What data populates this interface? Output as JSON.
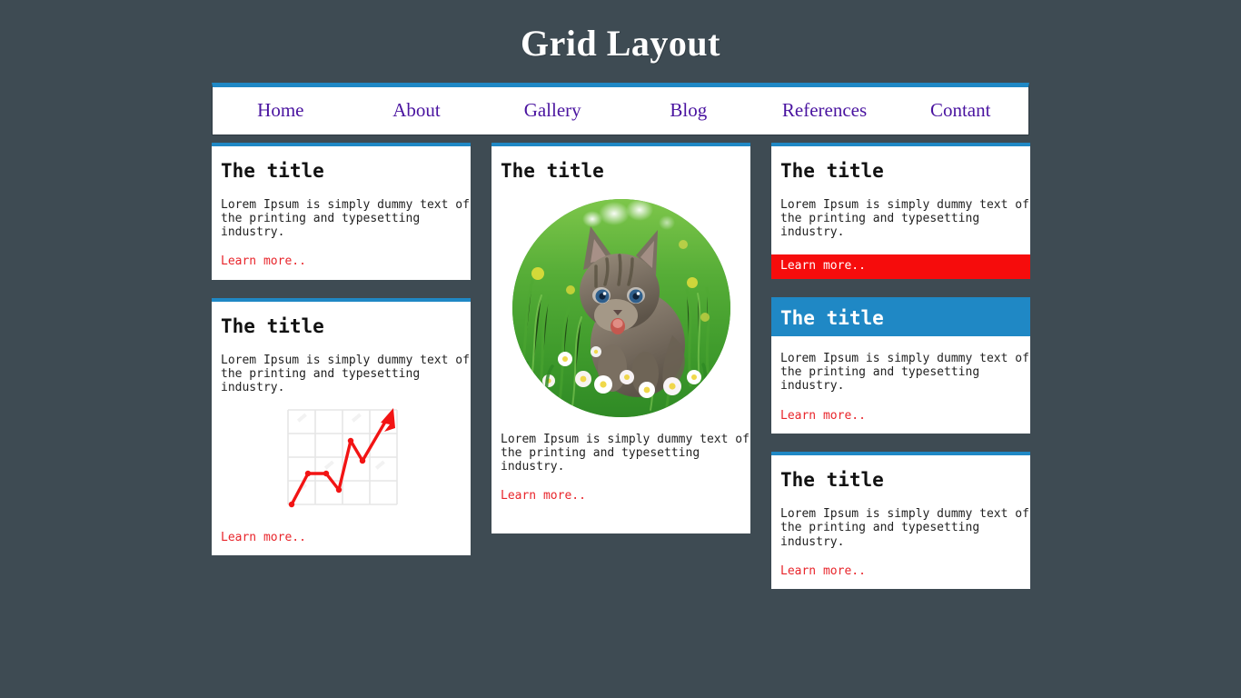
{
  "page": {
    "title": "Grid Layout",
    "background_color": "#3e4b53",
    "accent_blue": "#1f88c5",
    "accent_red": "#e8252b",
    "highlight_red": "#f60c0c",
    "link_purple": "#4a14a0"
  },
  "nav": {
    "items": [
      {
        "label": "Home"
      },
      {
        "label": "About"
      },
      {
        "label": "Gallery"
      },
      {
        "label": "Blog"
      },
      {
        "label": "References"
      },
      {
        "label": "Contant"
      }
    ]
  },
  "body_text": "Lorem Ipsum is simply dummy text of the printing and typesetting industry.",
  "cards": {
    "left_top": {
      "title": "The title",
      "text": "Lorem Ipsum is simply dummy text of the printing and typesetting industry.",
      "link": "Learn more.."
    },
    "left_bottom": {
      "title": "The title",
      "text": "Lorem Ipsum is simply dummy text of the printing and typesetting industry.",
      "link": "Learn more..",
      "image_alt": "red-upward-line-chart"
    },
    "center": {
      "title": "The title",
      "text": "Lorem Ipsum is simply dummy text of the printing and typesetting industry.",
      "link": "Learn more..",
      "image_alt": "kitten-in-grass-photo"
    },
    "right_top": {
      "title": "The title",
      "text": "Lorem Ipsum is simply dummy text of the printing and typesetting industry.",
      "link": "Learn more.."
    },
    "right_middle": {
      "title": "The title",
      "text": "Lorem Ipsum is simply dummy text of the printing and typesetting industry.",
      "link": "Learn more.."
    },
    "right_bottom": {
      "title": "The title",
      "text": "Lorem Ipsum is simply dummy text of the printing and typesetting industry.",
      "link": "Learn more.."
    }
  }
}
